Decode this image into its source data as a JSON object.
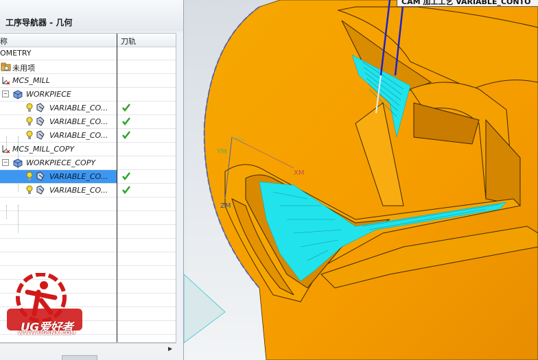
{
  "navigator": {
    "title": "工序导航器 - 几何",
    "col_name": "称",
    "col_toolpath": "刀轨",
    "rows": [
      {
        "label": "OMETRY",
        "check": false
      },
      {
        "label": "未用项",
        "check": false
      },
      {
        "label": "MCS_MILL",
        "check": false
      },
      {
        "label": "WORKPIECE",
        "check": false
      },
      {
        "label": "VARIABLE_CO...",
        "check": true
      },
      {
        "label": "VARIABLE_CO...",
        "check": true
      },
      {
        "label": "VARIABLE_CO...",
        "check": true
      },
      {
        "label": "MCS_MILL_COPY",
        "check": false
      },
      {
        "label": "WORKPIECE_COPY",
        "check": false
      },
      {
        "label": "VARIABLE_CO...",
        "check": true,
        "selected": true
      },
      {
        "label": "VARIABLE_CO...",
        "check": true
      }
    ],
    "check_color": "#2aa52a",
    "selection_color": "#3d97f0"
  },
  "viewport": {
    "window_title": "CAM 加工工艺 VARIABLE_CONTO",
    "axes": {
      "x": "XM",
      "y": "YM",
      "z": "ZM"
    },
    "part_color": "#f5a400",
    "toolpath_color": "#22e6ee"
  },
  "watermark": {
    "brand": "UG爱好者",
    "url": "WWW.UGSNX.COM"
  }
}
